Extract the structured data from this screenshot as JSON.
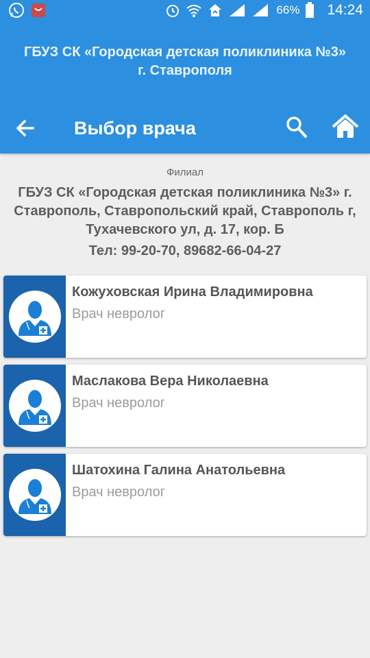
{
  "status_bar": {
    "battery": "66%",
    "time": "14:24",
    "icons": [
      "whatsapp-icon",
      "app-notification-icon",
      "alarm-icon",
      "wifi-icon",
      "sync-icon",
      "signal-icon",
      "signal-icon",
      "battery-icon"
    ]
  },
  "header": {
    "org_title": "ГБУЗ СК «Городская детская поликлиника №3» г. Ставрополя"
  },
  "toolbar": {
    "title": "Выбор врача",
    "icons": [
      "back-arrow-icon",
      "search-icon",
      "home-icon"
    ]
  },
  "branch": {
    "label": "Филиал",
    "name": "ГБУЗ СК «Городская детская поликлиника №3» г. Ставрополь, Ставропольский край, Ставрополь г, Тухачевского ул, д. 17, кор. Б",
    "phone": "Тел: 99-20-70, 89682-66-04-27"
  },
  "doctors": [
    {
      "name": "Кожуховская Ирина Владимировна",
      "specialty": "Врач невролог"
    },
    {
      "name": "Маслакова Вера Николаевна",
      "specialty": "Врач невролог"
    },
    {
      "name": "Шатохина Галина Анатольевна",
      "specialty": "Врач невролог"
    }
  ],
  "colors": {
    "primary": "#2d8fe0",
    "avatar_panel": "#1b63ac",
    "background": "#eeeeee"
  }
}
